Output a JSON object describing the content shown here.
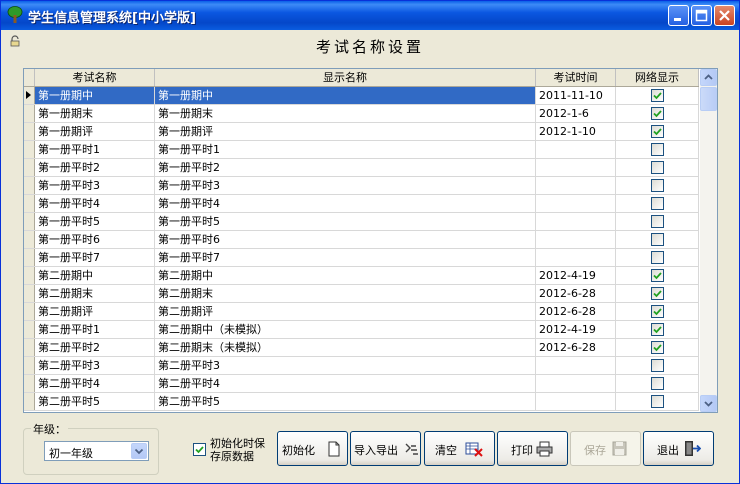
{
  "window": {
    "title": "学生信息管理系统[中小学版]"
  },
  "dialog_title": "考试名称设置",
  "grid": {
    "columns": [
      "考试名称",
      "显示名称",
      "考试时间",
      "网络显示"
    ],
    "rows": [
      {
        "name": "第一册期中",
        "display": "第一册期中",
        "time": "2011-11-10",
        "net": true
      },
      {
        "name": "第一册期末",
        "display": "第一册期末",
        "time": "2012-1-6",
        "net": true
      },
      {
        "name": "第一册期评",
        "display": "第一册期评",
        "time": "2012-1-10",
        "net": true
      },
      {
        "name": "第一册平时1",
        "display": "第一册平时1",
        "time": "",
        "net": false
      },
      {
        "name": "第一册平时2",
        "display": "第一册平时2",
        "time": "",
        "net": false
      },
      {
        "name": "第一册平时3",
        "display": "第一册平时3",
        "time": "",
        "net": false
      },
      {
        "name": "第一册平时4",
        "display": "第一册平时4",
        "time": "",
        "net": false
      },
      {
        "name": "第一册平时5",
        "display": "第一册平时5",
        "time": "",
        "net": false
      },
      {
        "name": "第一册平时6",
        "display": "第一册平时6",
        "time": "",
        "net": false
      },
      {
        "name": "第一册平时7",
        "display": "第一册平时7",
        "time": "",
        "net": false
      },
      {
        "name": "第二册期中",
        "display": "第二册期中",
        "time": "2012-4-19",
        "net": true
      },
      {
        "name": "第二册期末",
        "display": "第二册期末",
        "time": "2012-6-28",
        "net": true
      },
      {
        "name": "第二册期评",
        "display": "第二册期评",
        "time": "2012-6-28",
        "net": true
      },
      {
        "name": "第二册平时1",
        "display": "第二册期中（未模拟）",
        "time": "2012-4-19",
        "net": true
      },
      {
        "name": "第二册平时2",
        "display": "第二册期末（未模拟）",
        "time": "2012-6-28",
        "net": true
      },
      {
        "name": "第二册平时3",
        "display": "第二册平时3",
        "time": "",
        "net": false
      },
      {
        "name": "第二册平时4",
        "display": "第二册平时4",
        "time": "",
        "net": false
      },
      {
        "name": "第二册平时5",
        "display": "第二册平时5",
        "time": "",
        "net": false
      }
    ]
  },
  "grade": {
    "label": "年级：",
    "value": "初一年级"
  },
  "option": {
    "label": "初始化时保存原数据",
    "checked": true
  },
  "buttons": {
    "init": "初始化",
    "import_export": "导入导出",
    "clear": "清空",
    "print": "打印",
    "save": "保存",
    "exit": "退出"
  }
}
